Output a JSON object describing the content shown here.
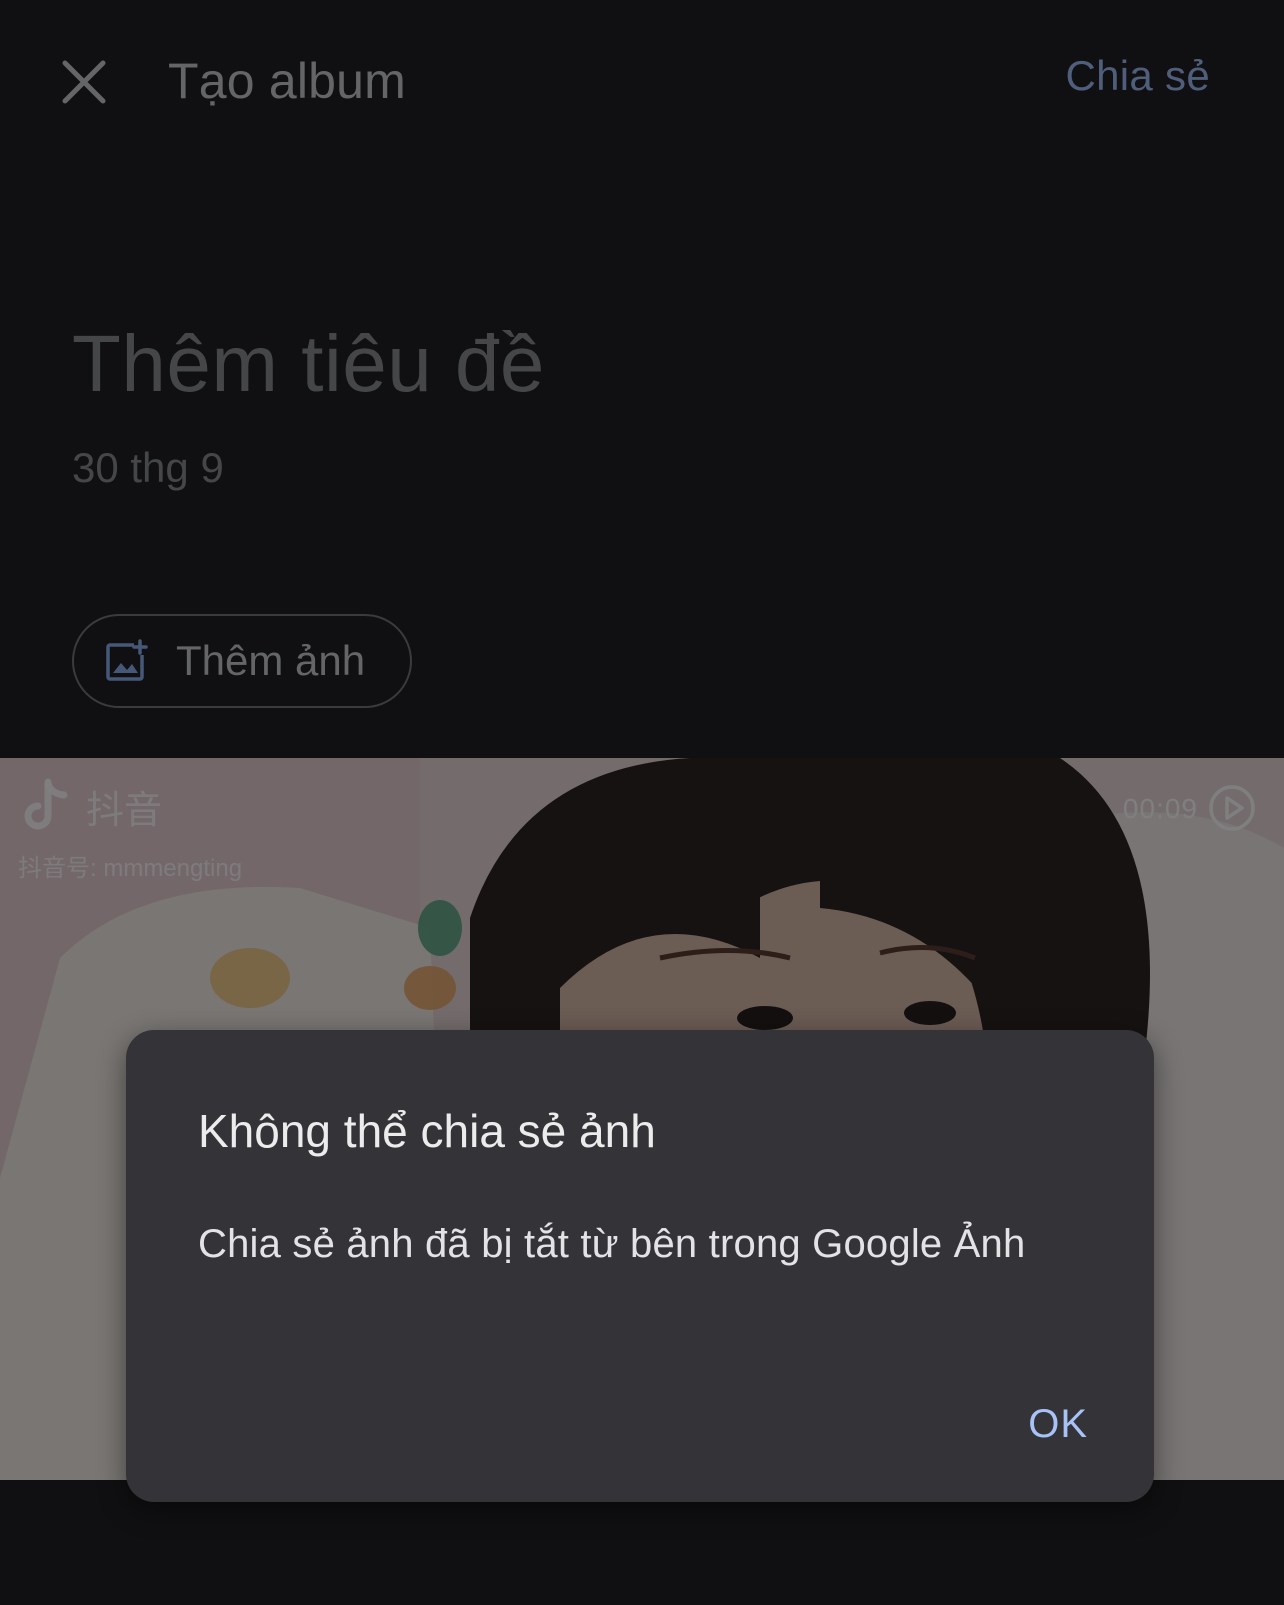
{
  "app_bar": {
    "close_icon": "close-icon",
    "title": "Tạo album",
    "share_label": "Chia sẻ"
  },
  "album": {
    "title_placeholder": "Thêm tiêu đề",
    "date": "30 thg 9",
    "add_photo_label": "Thêm ảnh",
    "add_photo_icon": "add-photo-icon"
  },
  "photo": {
    "brand_text": "抖音",
    "watermark_id": "抖音号: mmmengting",
    "duration": "00:09",
    "play_icon": "play-circle-icon"
  },
  "dialog": {
    "title": "Không thể chia sẻ ảnh",
    "message": "Chia sẻ ảnh đã bị tắt từ bên trong Google Ảnh",
    "ok_label": "OK"
  },
  "colors": {
    "background": "#202124",
    "accent": "#9fbcf4",
    "dialog_surface": "#343438",
    "dialog_action": "#a8c2f7"
  }
}
